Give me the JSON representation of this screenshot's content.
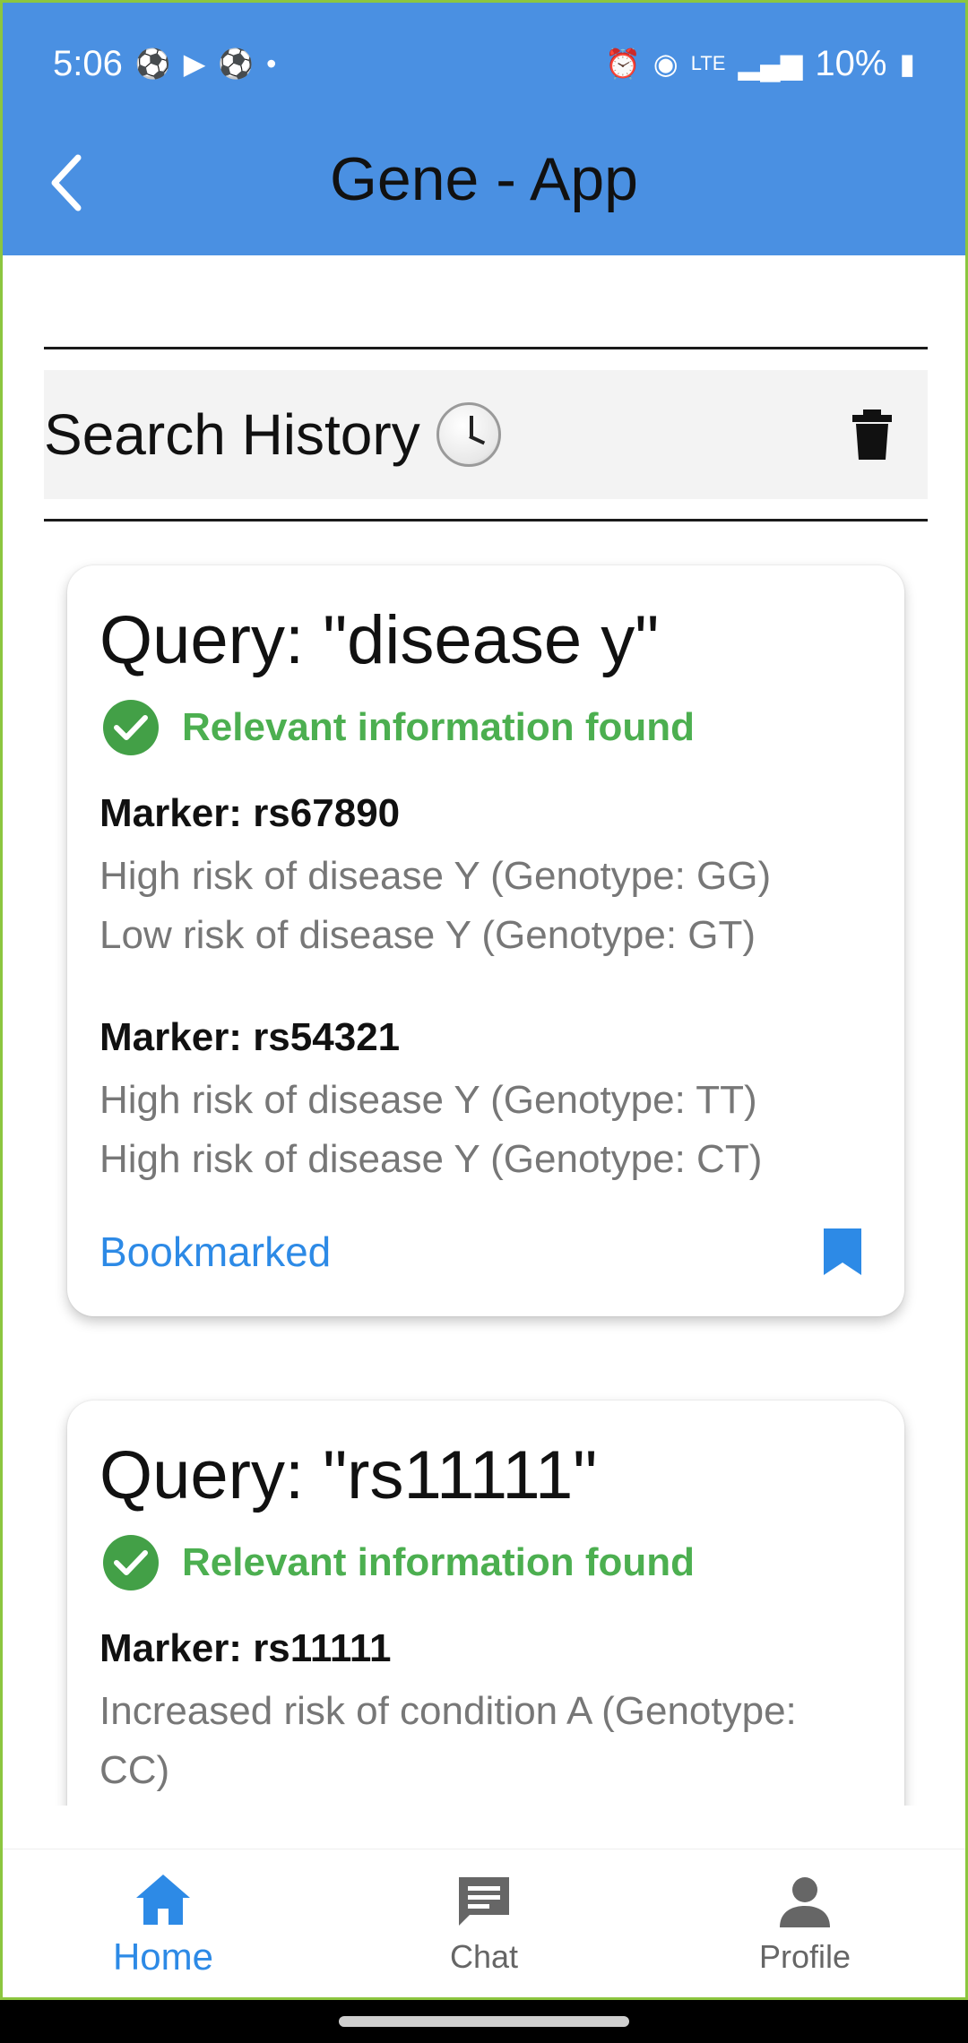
{
  "status_bar": {
    "time": "5:06",
    "battery": "10%"
  },
  "app_bar": {
    "title": "Gene - App"
  },
  "history": {
    "title": "Search History"
  },
  "cards": [
    {
      "query": "Query: \"disease y\"",
      "found": "Relevant information found",
      "markers": [
        {
          "marker": "Marker: rs67890",
          "lines": [
            "High risk of disease Y (Genotype: GG)",
            "Low risk of disease Y (Genotype: GT)"
          ]
        },
        {
          "marker": "Marker: rs54321",
          "lines": [
            "High risk of disease Y (Genotype: TT)",
            "High risk of disease Y (Genotype: CT)"
          ]
        }
      ],
      "bookmark_label": "Bookmarked"
    },
    {
      "query": "Query: \"rs11111\"",
      "found": "Relevant information found",
      "markers": [
        {
          "marker": "Marker: rs11111",
          "lines": [
            "Increased risk of condition A (Genotype: CC)"
          ]
        }
      ]
    }
  ],
  "nav": {
    "home": "Home",
    "chat": "Chat",
    "profile": "Profile"
  },
  "colors": {
    "app_bar": "#4a90e2",
    "accent": "#2d8ae6",
    "success": "#4caf50"
  }
}
